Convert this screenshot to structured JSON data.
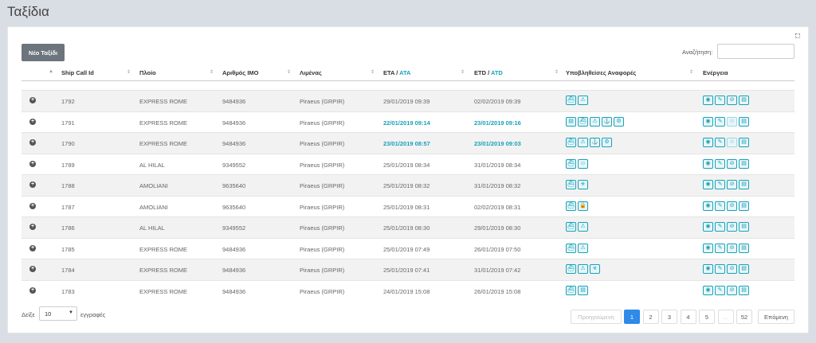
{
  "title": "Ταξίδια",
  "new_trip_label": "Νέο Ταξίδι",
  "search": {
    "label": "Αναζήτηση:",
    "value": ""
  },
  "columns": {
    "ship_call_id": "Ship Call Id",
    "ship": "Πλοίο",
    "imo": "Αριθμός IMO",
    "port": "Λιμένας",
    "eta": "ETA /",
    "ata": "ATA",
    "etd": "ETD /",
    "atd": "ATD",
    "reports": "Υποβληθείσες Αναφορές",
    "actions": "Ενέργεια"
  },
  "rows": [
    {
      "id": "1792",
      "ship": "EXPRESS ROME",
      "imo": "9484936",
      "port": "Piraeus (GRPIR)",
      "eta": "29/01/2019 09:39",
      "etd": "02/02/2019 09:39",
      "eta_actual": false,
      "etd_actual": false,
      "reports": [
        "ship-icon",
        "warning-icon"
      ]
    },
    {
      "id": "1791",
      "ship": "EXPRESS ROME",
      "imo": "9484936",
      "port": "Piraeus (GRPIR)",
      "eta": "22/01/2019 09:14",
      "etd": "23/01/2019 09:16",
      "eta_actual": true,
      "etd_actual": true,
      "reports": [
        "document-icon",
        "ship-icon",
        "warning-icon",
        "anchor-icon",
        "gear-icon"
      ]
    },
    {
      "id": "1790",
      "ship": "EXPRESS ROME",
      "imo": "9484936",
      "port": "Piraeus (GRPIR)",
      "eta": "23/01/2019 08:57",
      "etd": "23/01/2019 09:03",
      "eta_actual": true,
      "etd_actual": true,
      "reports": [
        "ship-icon",
        "warning-icon",
        "anchor-icon",
        "gear-icon"
      ]
    },
    {
      "id": "1789",
      "ship": "AL HILAL",
      "imo": "9349552",
      "port": "Piraeus (GRPIR)",
      "eta": "25/01/2019 08:34",
      "etd": "31/01/2019 08:34",
      "eta_actual": false,
      "etd_actual": false,
      "reports": [
        "ship-icon",
        "crew-icon"
      ]
    },
    {
      "id": "1788",
      "ship": "AMOLIANI",
      "imo": "9635640",
      "port": "Piraeus (GRPIR)",
      "eta": "25/01/2019 08:32",
      "etd": "31/01/2019 08:32",
      "eta_actual": false,
      "etd_actual": false,
      "reports": [
        "ship-icon",
        "biohazard-icon"
      ]
    },
    {
      "id": "1787",
      "ship": "AMOLIANI",
      "imo": "9635640",
      "port": "Piraeus (GRPIR)",
      "eta": "25/01/2019 08:31",
      "etd": "02/02/2019 08:31",
      "eta_actual": false,
      "etd_actual": false,
      "reports": [
        "ship-icon",
        "lock-icon"
      ]
    },
    {
      "id": "1786",
      "ship": "AL HILAL",
      "imo": "9349552",
      "port": "Piraeus (GRPIR)",
      "eta": "25/01/2019 08:30",
      "etd": "29/01/2019 08:30",
      "eta_actual": false,
      "etd_actual": false,
      "reports": [
        "ship-icon",
        "warning-icon"
      ]
    },
    {
      "id": "1785",
      "ship": "EXPRESS ROME",
      "imo": "9484936",
      "port": "Piraeus (GRPIR)",
      "eta": "25/01/2019 07:49",
      "etd": "26/01/2019 07:50",
      "eta_actual": false,
      "etd_actual": false,
      "reports": [
        "ship-icon",
        "warning-icon"
      ]
    },
    {
      "id": "1784",
      "ship": "EXPRESS ROME",
      "imo": "9484936",
      "port": "Piraeus (GRPIR)",
      "eta": "25/01/2019 07:41",
      "etd": "31/01/2019 07:42",
      "eta_actual": false,
      "etd_actual": false,
      "reports": [
        "ship-icon",
        "warning-icon",
        "biohazard-icon"
      ]
    },
    {
      "id": "1783",
      "ship": "EXPRESS ROME",
      "imo": "9484936",
      "port": "Piraeus (GRPIR)",
      "eta": "24/01/2019 15:08",
      "etd": "26/01/2019 15:08",
      "eta_actual": false,
      "etd_actual": false,
      "reports": [
        "ship-icon",
        "document-icon"
      ]
    }
  ],
  "row_actions": [
    "view-icon",
    "edit-icon",
    "cancel-icon",
    "document-icon"
  ],
  "footer": {
    "show_label": "Δείξε",
    "page_length": "10",
    "entries_label": "εγγραφές"
  },
  "pagination": {
    "previous": "Προηγούμενη",
    "pages": [
      "1",
      "2",
      "3",
      "4",
      "5",
      "…",
      "52"
    ],
    "active": "1",
    "next": "Επόμενη"
  },
  "colors": {
    "accent": "#17a2b8",
    "active_page": "#2f8ae8",
    "button": "#6c757d"
  }
}
